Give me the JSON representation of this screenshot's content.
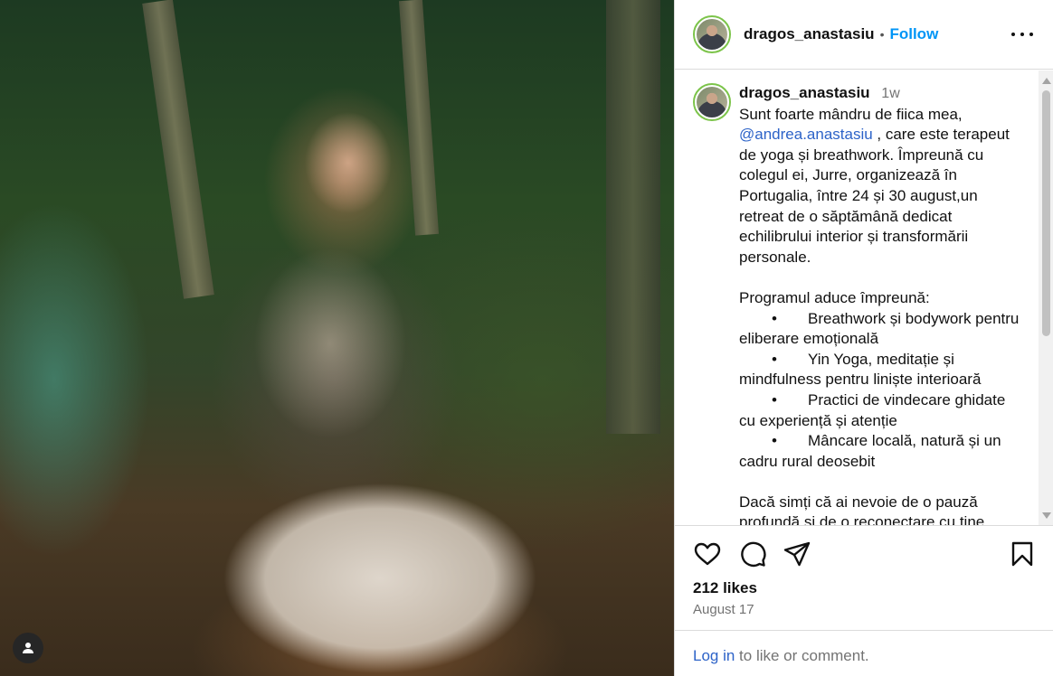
{
  "post": {
    "username": "dragos_anastasiu",
    "separator": "•",
    "follow_label": "Follow"
  },
  "caption": {
    "username": "dragos_anastasiu",
    "time": "1w",
    "intro_1": "Sunt foarte mândru de fiica mea,",
    "mention": "@andrea.anastasiu",
    "intro_2": " , care este terapeut de yoga și breathwork. Împreună cu colegul ei, Jurre, organizează în Portugalia, între 24 și 30 august,un retreat de o săptămână dedicat echilibrului interior și transformării personale.",
    "program_heading": "Programul aduce împreună:",
    "bullet_symbol": "•",
    "bullets": [
      "Breathwork și bodywork pentru eliberare emoțională",
      "Yin Yoga, meditație și mindfulness pentru liniște interioară",
      "Practici de vindecare ghidate cu experiență și atenție",
      "Mâncare locală, natură și un cadru rural deosebit"
    ],
    "closing": "Dacă simți că ai nevoie de o pauză profundă și de o reconectare cu tine"
  },
  "stats": {
    "likes": "212 likes",
    "date": "August 17"
  },
  "login": {
    "link": "Log in",
    "rest": " to like or comment."
  },
  "icons": {
    "like": "heart-icon",
    "comment": "comment-icon",
    "share": "share-icon",
    "save": "bookmark-icon",
    "more": "more-options-icon",
    "user": "user-icon"
  },
  "colors": {
    "accent": "#0095f6",
    "link": "#2d63c8",
    "muted": "#737373",
    "avatar_ring": "#7cc44a"
  }
}
